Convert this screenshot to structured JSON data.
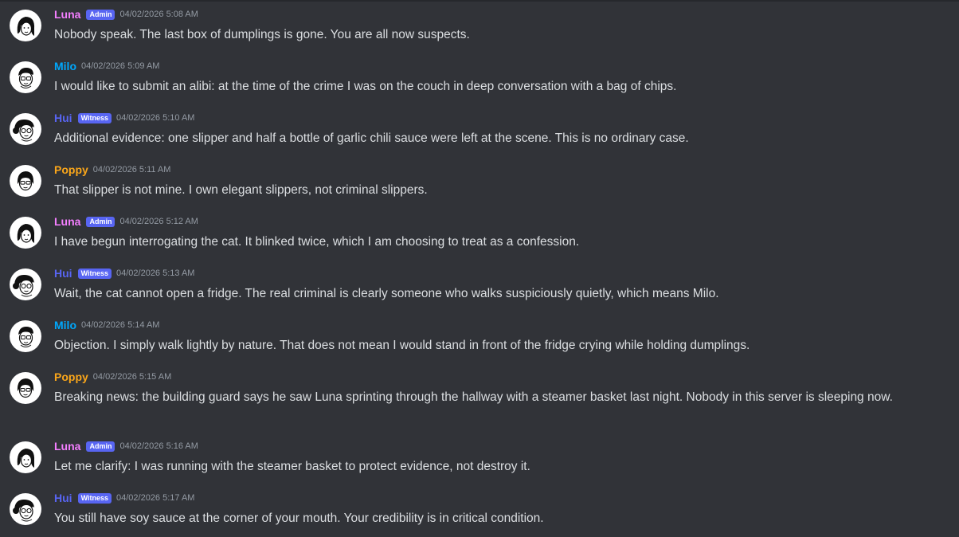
{
  "colors": {
    "background": "#313338",
    "text": "#dbdee1",
    "timestamp": "#949ba4",
    "badge": "#5865f2",
    "luna": "#f47fff",
    "milo": "#00a8fc",
    "hui": "#5865f2",
    "poppy": "#faa61a"
  },
  "messages": [
    {
      "author": "Luna",
      "badge": "Admin",
      "time": "04/02/2026 5:08 AM",
      "text": "Nobody speak. The last box of dumplings is gone. You are all now suspects."
    },
    {
      "author": "Milo",
      "badge": "",
      "time": "04/02/2026 5:09 AM",
      "text": "I would like to submit an alibi: at the time of the crime I was on the couch in deep conversation with a bag of chips."
    },
    {
      "author": "Hui",
      "badge": "Witness",
      "time": "04/02/2026 5:10 AM",
      "text": "Additional evidence: one slipper and half a bottle of garlic chili sauce were left at the scene. This is no ordinary case."
    },
    {
      "author": "Poppy",
      "badge": "",
      "time": "04/02/2026 5:11 AM",
      "text": "That slipper is not mine. I own elegant slippers, not criminal slippers."
    },
    {
      "author": "Luna",
      "badge": "Admin",
      "time": "04/02/2026 5:12 AM",
      "text": "I have begun interrogating the cat. It blinked twice, which I am choosing to treat as a confession."
    },
    {
      "author": "Hui",
      "badge": "Witness",
      "time": "04/02/2026 5:13 AM",
      "text": "Wait, the cat cannot open a fridge. The real criminal is clearly someone who walks suspiciously quietly, which means Milo."
    },
    {
      "author": "Milo",
      "badge": "",
      "time": "04/02/2026 5:14 AM",
      "text": "Objection. I simply walk lightly by nature. That does not mean I would stand in front of the fridge crying while holding dumplings."
    },
    {
      "author": "Poppy",
      "badge": "",
      "time": "04/02/2026 5:15 AM",
      "text": "Breaking news: the building guard says he saw Luna sprinting through the hallway with a steamer basket last night. Nobody in this server is sleeping now."
    },
    {
      "author": "Luna",
      "badge": "Admin",
      "time": "04/02/2026 5:16 AM",
      "text": "Let me clarify: I was running with the steamer basket to protect evidence, not destroy it."
    },
    {
      "author": "Hui",
      "badge": "Witness",
      "time": "04/02/2026 5:17 AM",
      "text": "You still have soy sauce at the corner of your mouth. Your credibility is in critical condition."
    }
  ]
}
